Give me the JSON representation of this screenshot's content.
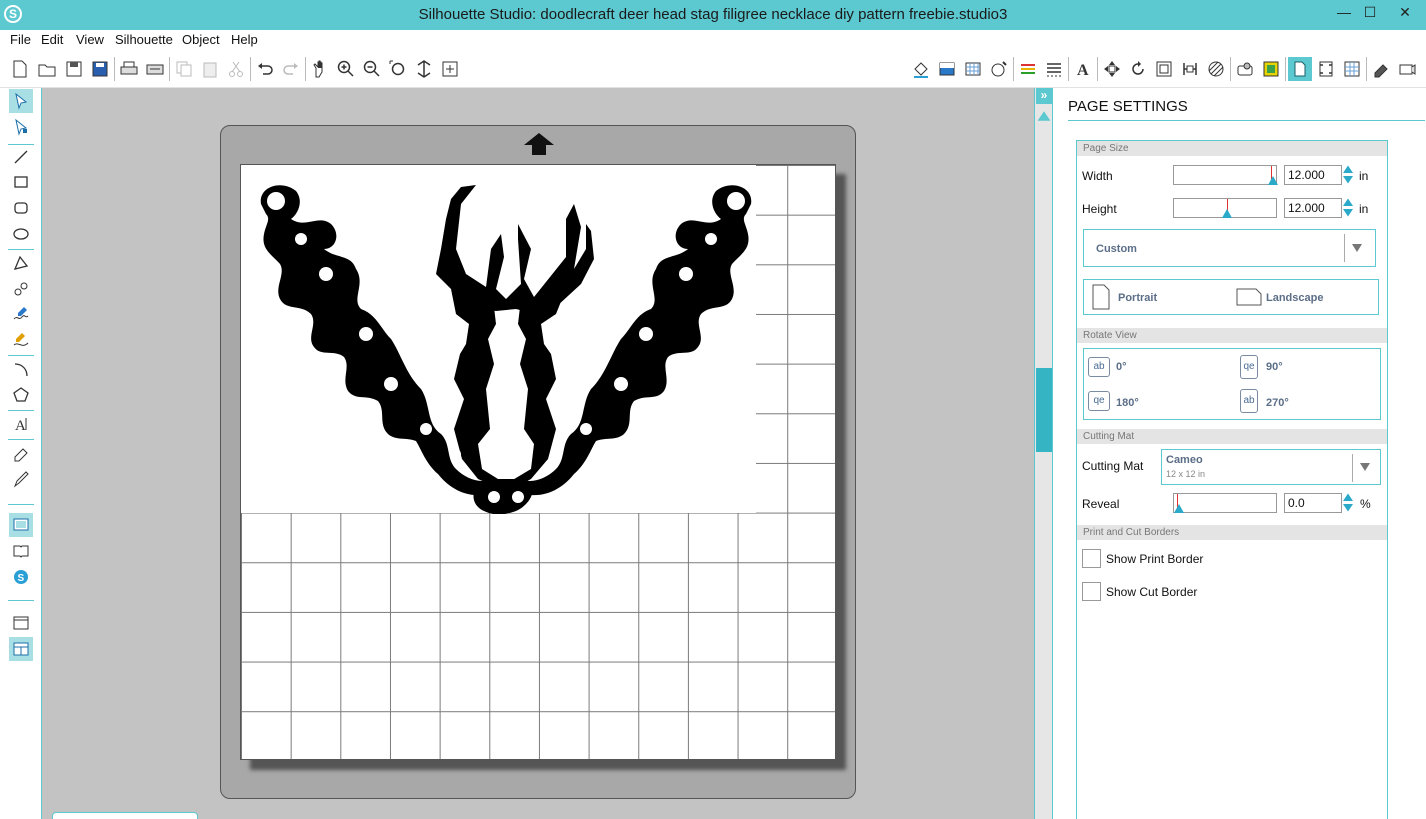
{
  "window": {
    "title": "Silhouette Studio: doodlecraft deer head stag filigree necklace diy pattern freebie.studio3",
    "logo_glyph": "S",
    "minimize_glyph": "—",
    "maximize_glyph": "☐",
    "close_glyph": "✕"
  },
  "menu": [
    "File",
    "Edit",
    "View",
    "Silhouette",
    "Object",
    "Help"
  ],
  "toolbar": {
    "left_icons": [
      "new-file-icon",
      "open-folder-icon",
      "save-icon",
      "save-library-icon",
      "print-icon",
      "print-cut-icon",
      "copy-icon",
      "paste-icon",
      "cut-icon",
      "undo-icon",
      "redo-icon",
      "pan-icon",
      "zoom-in-icon",
      "zoom-out-icon",
      "zoom-select-icon",
      "zoom-drag-icon",
      "zoom-fit-icon"
    ],
    "right_icons": [
      "fill-color-icon",
      "fill-gradient-icon",
      "fill-pattern-icon",
      "shadow-icon",
      "line-color-icon",
      "line-style-icon",
      "text-style-icon",
      "transform-icon",
      "replicate-icon",
      "offset-icon",
      "trace-icon",
      "modify-icon",
      "knife-icon",
      "cut-settings-icon",
      "send-to-silhouette-icon",
      "page-settings-icon",
      "registration-marks-icon",
      "grid-settings-icon",
      "eraser-panel-icon",
      "library-icon"
    ]
  },
  "left_tools": [
    "select-tool-icon",
    "point-edit-tool-icon",
    "line-tool-icon",
    "rectangle-tool-icon",
    "rounded-rectangle-tool-icon",
    "ellipse-tool-icon",
    "polygon-tool-icon",
    "curve-tool-icon",
    "freehand-tool-icon",
    "smooth-freehand-tool-icon",
    "arc-tool-icon",
    "regular-polygon-tool-icon",
    "text-tool-icon",
    "eraser-tool-icon",
    "knife-tool-icon",
    "design-view-icon",
    "library-view-icon",
    "store-view-icon",
    "single-view-icon",
    "split-view-icon"
  ],
  "panel": {
    "title": "PAGE SETTINGS",
    "page_size": {
      "header": "Page Size",
      "width_label": "Width",
      "width_value": "12.000",
      "height_label": "Height",
      "height_value": "12.000",
      "unit": "in",
      "preset": "Custom",
      "portrait_label": "Portrait",
      "landscape_label": "Landscape"
    },
    "rotate_view": {
      "header": "Rotate View",
      "options": [
        {
          "label": "0°",
          "glyph": "ab"
        },
        {
          "label": "90°",
          "glyph": "qe"
        },
        {
          "label": "180°",
          "glyph": "qe"
        },
        {
          "label": "270°",
          "glyph": "ab"
        }
      ]
    },
    "cutting_mat": {
      "header": "Cutting Mat",
      "label": "Cutting Mat",
      "value": "Cameo",
      "sub_value": "12 x 12 in",
      "reveal_label": "Reveal",
      "reveal_value": "0.0",
      "reveal_unit": "%"
    },
    "borders": {
      "header": "Print and Cut Borders",
      "show_print_border": "Show Print Border",
      "show_cut_border": "Show Cut Border"
    }
  },
  "colors": {
    "accent": "#5cc8cf",
    "workspace": "#c3c3c3",
    "mat": "#a8a8a8"
  }
}
